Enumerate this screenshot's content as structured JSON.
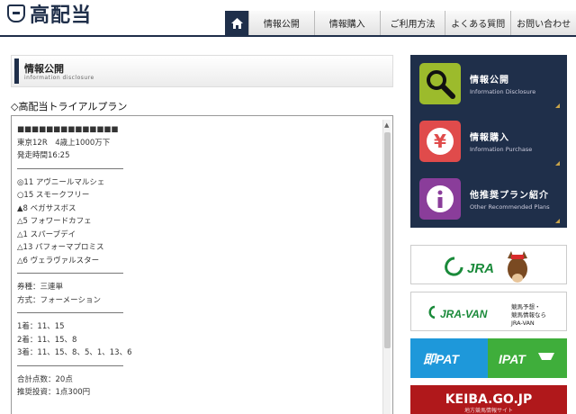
{
  "header": {
    "logo_text": "高配当",
    "nav": [
      "情報公開",
      "情報購入",
      "ご利用方法",
      "よくある質問",
      "お問い合わせ"
    ]
  },
  "page_heading": {
    "title": "情報公開",
    "subtitle": "information disclosure"
  },
  "plan": {
    "title": "◇高配当トライアルプラン",
    "masked": "■■■■■■■■■■■■■■",
    "race": "東京12R　4歳上1000万下",
    "start_time": "発走時間16:25",
    "horses": [
      "◎11 アヴニールマルシェ",
      "○15 スモークフリー",
      "▲8 ベガサスボス",
      "△5 フォワードカフェ",
      "△1 スパーブデイ",
      "△13 パフォーマプロミス",
      "△6 ヴェラヴァルスター"
    ],
    "ticket_type": "券種：三連単",
    "method": "方式：フォーメーション",
    "formation": [
      "1着：11、15",
      "2着：11、15、8",
      "3着：11、15、8、5、1、13、6"
    ],
    "total": "合計点数：20点",
    "stake": "推奨投資：1点300円"
  },
  "sidebar": {
    "cards": [
      {
        "title": "情報公開",
        "subtitle": "Information Disclosure",
        "icon": "magnifier-icon",
        "color": "#9cbb2c"
      },
      {
        "title": "情報購入",
        "subtitle": "Information Purchase",
        "icon": "yen-icon",
        "color": "#e04b4b"
      },
      {
        "title": "他推奨プラン紹介",
        "subtitle": "Other Recommended Plans",
        "icon": "info-icon",
        "color": "#8a3d9a"
      }
    ],
    "banners": {
      "jra": "JRA",
      "jravan": "JRA-VAN",
      "jravan_note1": "競馬予想・",
      "jravan_note2": "競馬情報なら",
      "jravan_note3": "JRA-VAN",
      "pat_left": "即PAT",
      "pat_right": "IPAT",
      "keiba": "KEIBA.GO.JP",
      "keiba_sub": "地方競馬情報サイト"
    }
  },
  "colors": {
    "navy": "#1f2f4a",
    "accent_green": "#9cbb2c",
    "accent_red": "#e04b4b",
    "accent_purple": "#8a3d9a"
  }
}
